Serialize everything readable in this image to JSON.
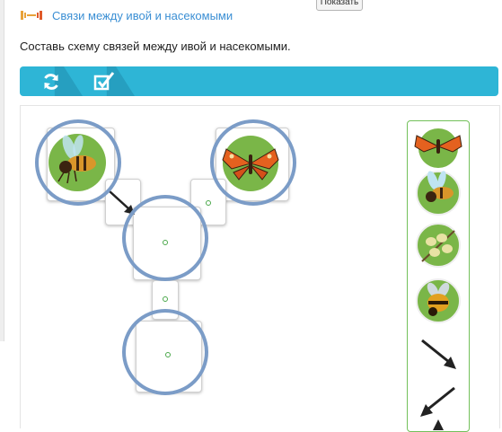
{
  "header": {
    "title": "Связи между ивой и насекомыми",
    "show_button": "Показать"
  },
  "instruction": "Составь схему связей между ивой и насекомыми.",
  "toolbar": {
    "buttons": [
      {
        "name": "reset-button",
        "icon": "reset-icon"
      },
      {
        "name": "check-button",
        "icon": "check-icon"
      }
    ]
  },
  "colors": {
    "accent": "#2eb5d6",
    "title": "#3b8fd4",
    "ring": "#7b9cc7",
    "palette_border": "#73c05a",
    "tile_green": "#7ab648"
  },
  "scheme": {
    "placed_items": [
      "bee",
      "butterfly",
      "arrow-down-right"
    ],
    "empty_slots": 5
  },
  "palette": {
    "items": [
      "butterfly",
      "bee",
      "willow-catkins",
      "bumblebee",
      "arrow-down-right",
      "arrow-down-left",
      "arrow-up"
    ]
  }
}
